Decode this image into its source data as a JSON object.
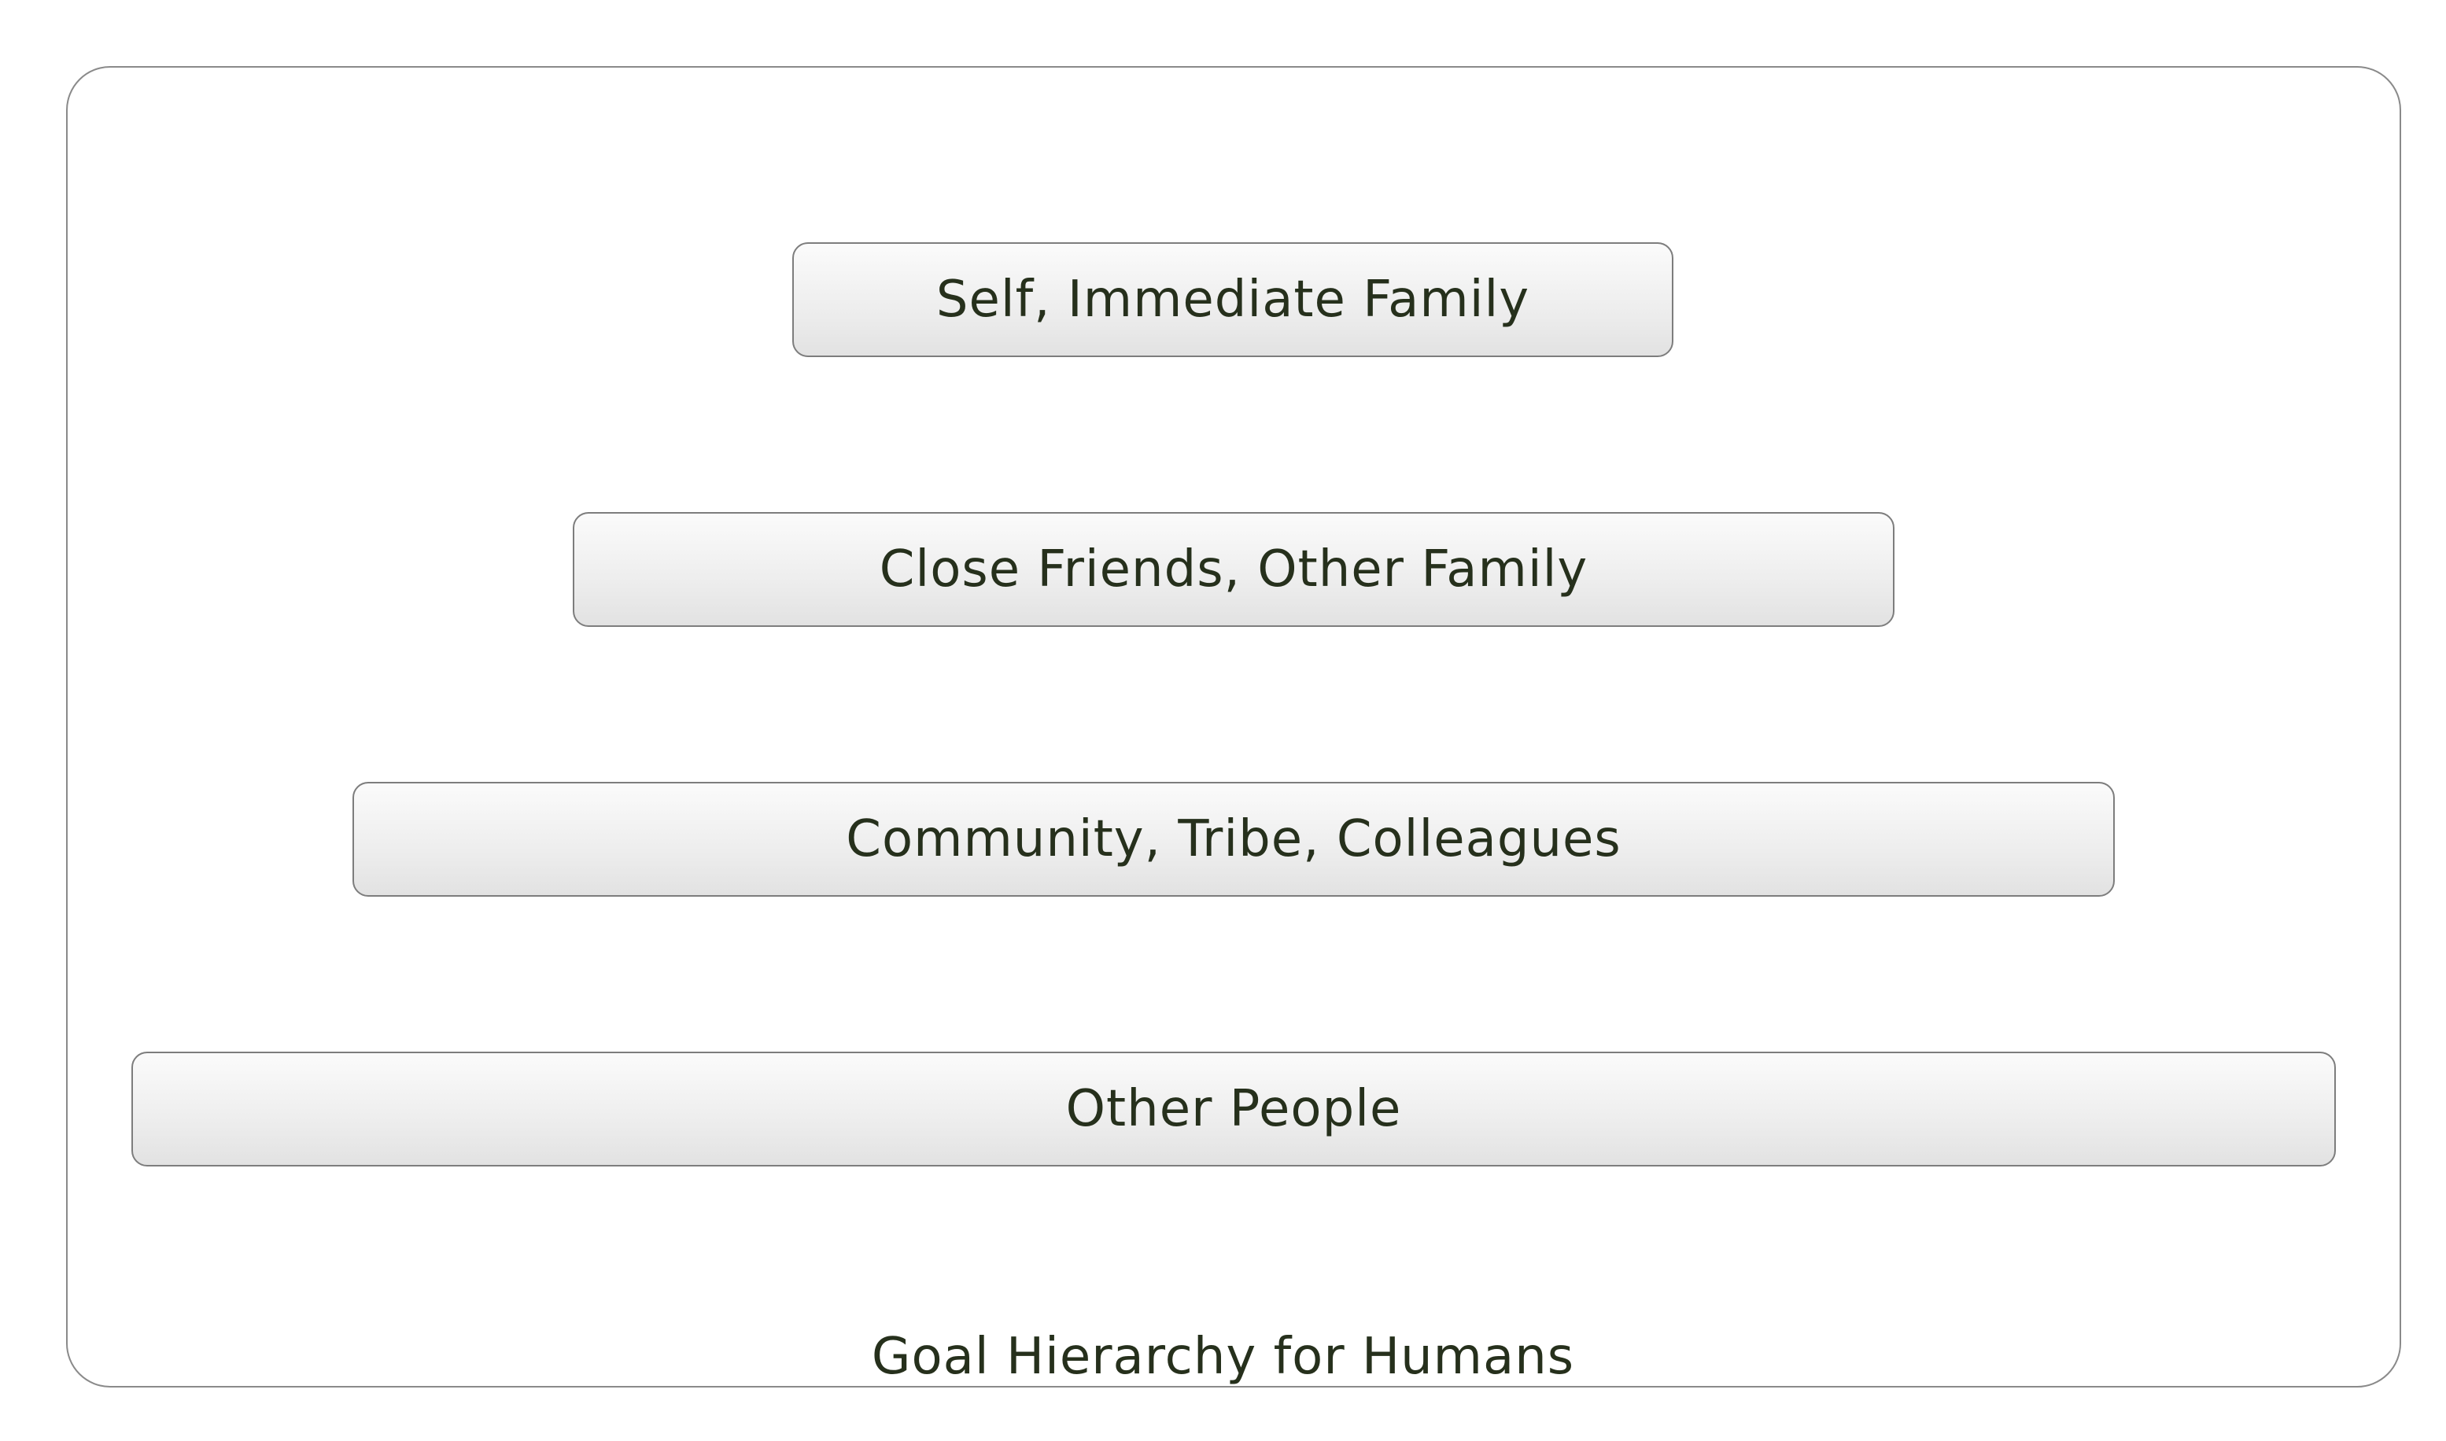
{
  "diagram": {
    "caption": "Goal Hierarchy for Humans",
    "tiers": [
      {
        "label": "Self, Immediate Family"
      },
      {
        "label": "Close Friends, Other Family"
      },
      {
        "label": "Community, Tribe, Colleagues"
      },
      {
        "label": "Other People"
      }
    ]
  }
}
